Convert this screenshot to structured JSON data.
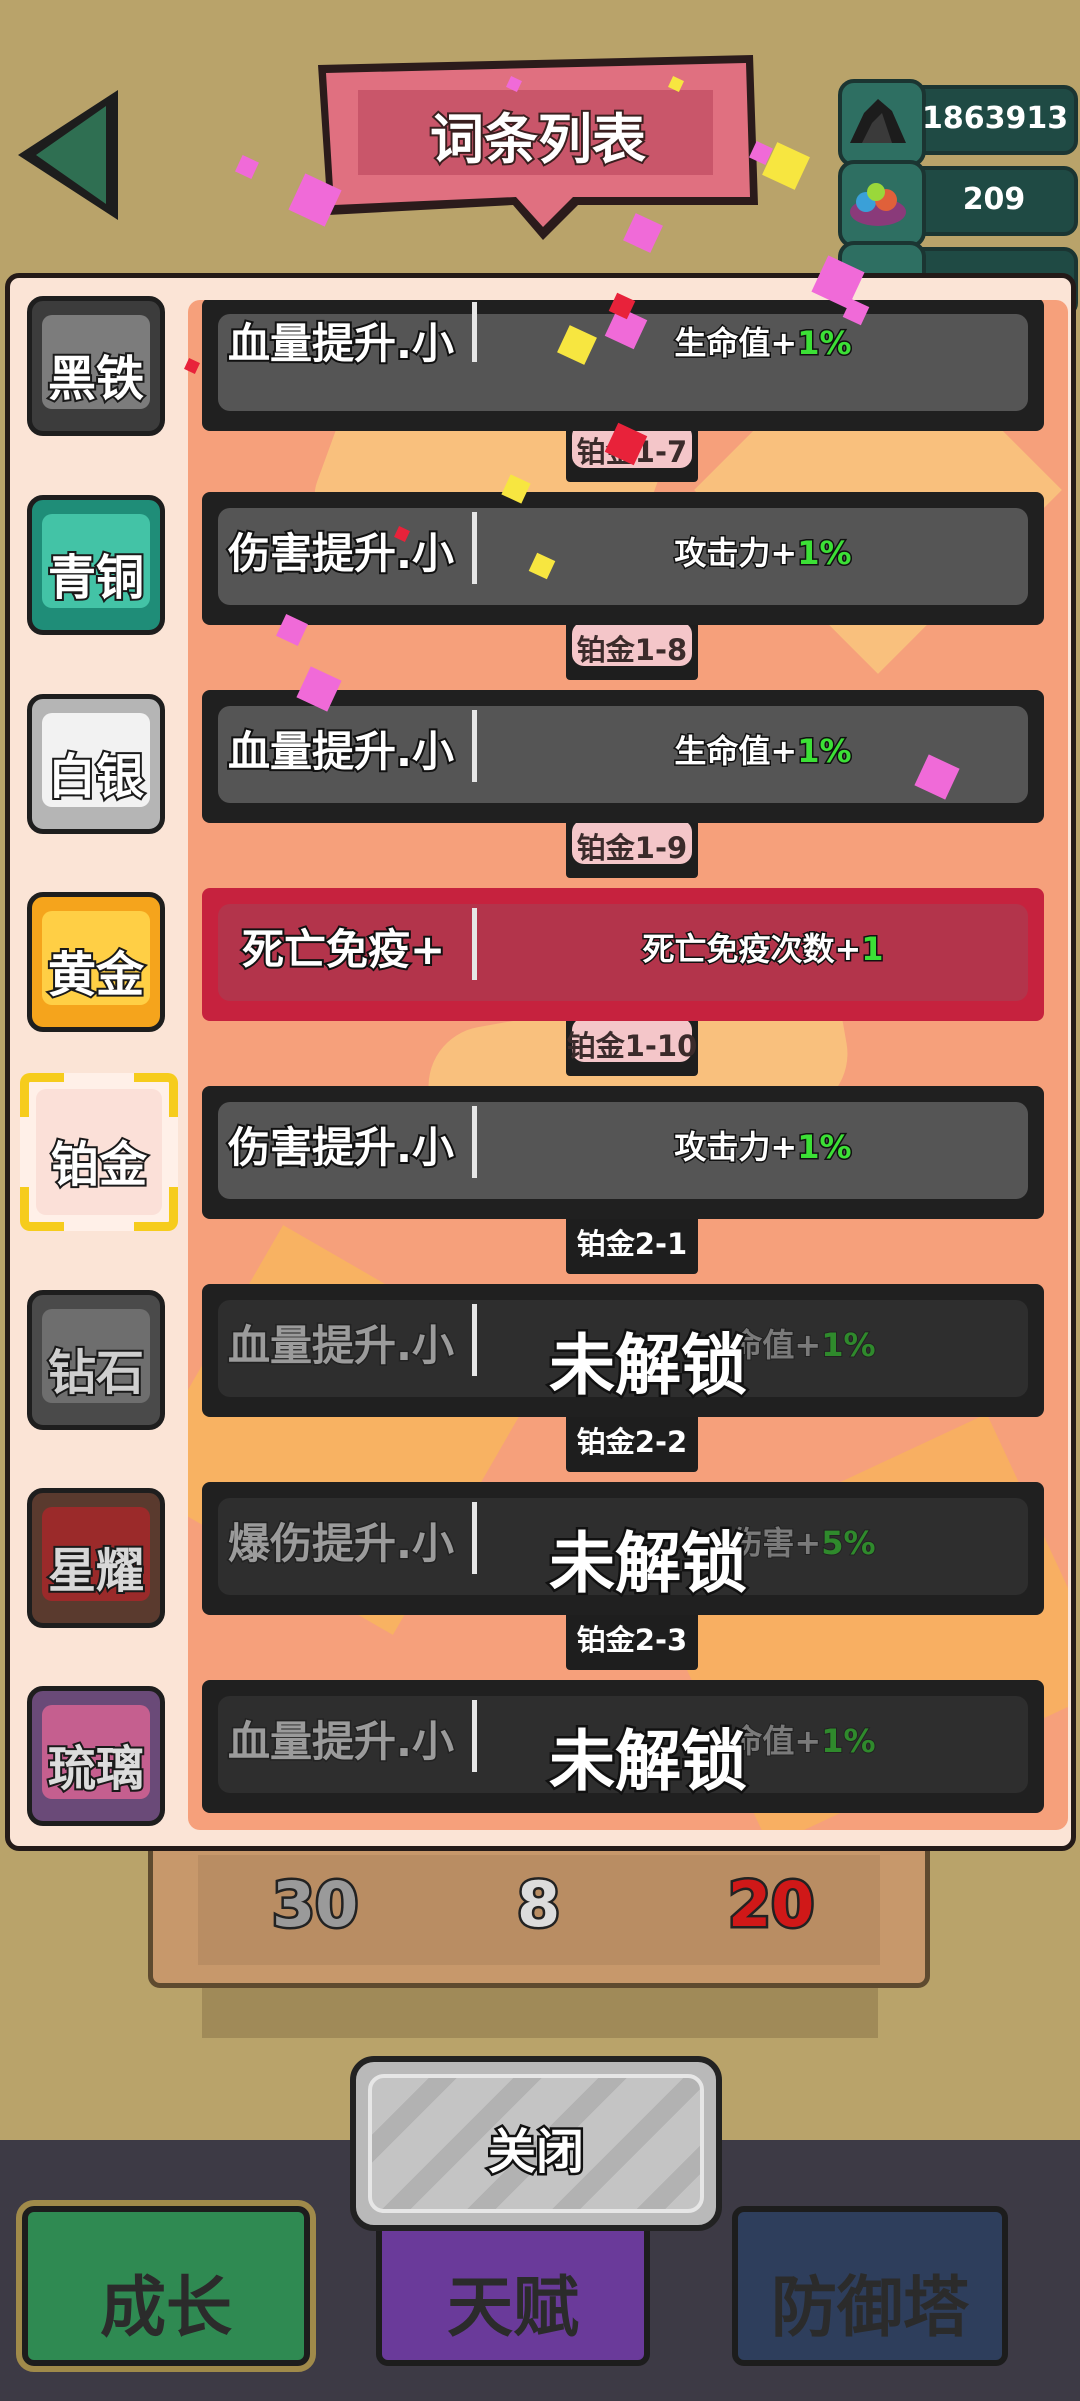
{
  "header": {
    "title": "词条列表",
    "resources": [
      {
        "icon": "coal-pile-icon",
        "value": "1863913"
      },
      {
        "icon": "gem-pile-icon",
        "value": "209"
      },
      {
        "icon": "ore-icon",
        "value": ""
      }
    ]
  },
  "tiers": [
    {
      "label": "黑铁",
      "color": "#3c3c3c",
      "inner": "#7c7c7c"
    },
    {
      "label": "青铜",
      "color": "#1f8d78",
      "inner": "#43c3a6"
    },
    {
      "label": "白银",
      "color": "#b5b5b5",
      "inner": "#f2f2f2"
    },
    {
      "label": "黄金",
      "color": "#f5a41c",
      "inner": "#ffcf45"
    },
    {
      "label": "铂金",
      "color": "#fff0e8",
      "inner": "#fbe0d8"
    },
    {
      "label": "钻石",
      "color": "#4a4a4a",
      "inner": "#6e6e6e"
    },
    {
      "label": "星耀",
      "color": "#5a3a2e",
      "inner": "#9b2a2a"
    },
    {
      "label": "琉璃",
      "color": "#6a4a78",
      "inner": "#c55f8f"
    }
  ],
  "entries": [
    {
      "name": "血量提升.小",
      "effect_text": "生命值+",
      "effect_value": "1%",
      "locked": false,
      "special": false
    },
    {
      "name": "伤害提升.小",
      "effect_text": "攻击力+",
      "effect_value": "1%",
      "locked": false,
      "special": false
    },
    {
      "name": "血量提升.小",
      "effect_text": "生命值+",
      "effect_value": "1%",
      "locked": false,
      "special": false
    },
    {
      "name": "死亡免疫+",
      "effect_text": "死亡免疫次数+",
      "effect_value": "1",
      "locked": false,
      "special": true
    },
    {
      "name": "伤害提升.小",
      "effect_text": "攻击力+",
      "effect_value": "1%",
      "locked": false,
      "special": false
    },
    {
      "name": "血量提升.小",
      "effect_text": "命值+",
      "effect_value": "1%",
      "locked": true,
      "special": false
    },
    {
      "name": "爆伤提升.小",
      "effect_text": "伤害+",
      "effect_value": "5%",
      "locked": true,
      "special": false
    },
    {
      "name": "血量提升.小",
      "effect_text": "命值+",
      "effect_value": "1%",
      "locked": true,
      "special": false
    }
  ],
  "lock_text": "未解锁",
  "connectors": [
    {
      "label": "铂金1-7",
      "active": true
    },
    {
      "label": "铂金1-8",
      "active": true
    },
    {
      "label": "铂金1-9",
      "active": true
    },
    {
      "label": "铂金1-10",
      "active": true
    },
    {
      "label": "铂金2-1",
      "active": false
    },
    {
      "label": "铂金2-2",
      "active": false
    },
    {
      "label": "铂金2-3",
      "active": false
    }
  ],
  "behind_values": [
    "30",
    "8",
    "20"
  ],
  "close_label": "关闭",
  "nav": [
    {
      "label": "成长",
      "color": "#2f8a52"
    },
    {
      "label": "天赋",
      "color": "#6a3a9a"
    },
    {
      "label": "防御塔",
      "color": "#2e3e5c"
    }
  ]
}
